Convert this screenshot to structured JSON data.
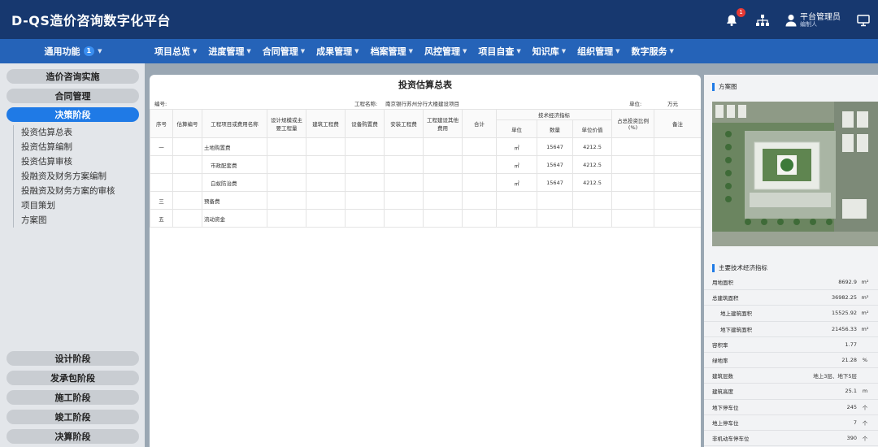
{
  "header": {
    "title": "D-QS造价咨询数字化平台",
    "notification_count": "1",
    "user_name": "平台管理员",
    "user_role": "编制人"
  },
  "nav": {
    "general_label": "通用功能",
    "general_count": "1",
    "items": [
      "项目总览",
      "进度管理",
      "合同管理",
      "成果管理",
      "档案管理",
      "风控管理",
      "项目自查",
      "知识库",
      "组织管理",
      "数字服务"
    ]
  },
  "sidebar": {
    "stages_top": [
      "造价咨询实施",
      "合同管理",
      "决策阶段"
    ],
    "active_stage": "决策阶段",
    "sub_items": [
      "投资估算总表",
      "投资估算编制",
      "投资估算审核",
      "投融资及财务方案编制",
      "投融资及财务方案的审核",
      "项目策划",
      "方案图"
    ],
    "stages_bottom": [
      "设计阶段",
      "发承包阶段",
      "施工阶段",
      "竣工阶段",
      "决算阶段"
    ]
  },
  "table": {
    "title": "投资估算总表",
    "code_label": "编号:",
    "project_label": "工程名称:",
    "project_name": "南京银行苏州分行大楼建设项目",
    "unit_label": "单位:",
    "unit_value": "万元",
    "headers": {
      "seq": "序号",
      "code": "估算编号",
      "name": "工程项目或费用名称",
      "design": "设计规模或主要工程量",
      "build": "建筑工程费",
      "equip": "设备购置费",
      "install": "安装工程费",
      "other": "工程建设其他费用",
      "total": "合计",
      "tech_group": "技术经济指标",
      "t_unit": "单位",
      "t_qty": "数量",
      "t_price": "单位价值",
      "ratio": "占总投资比例(%)",
      "note": "备注"
    },
    "rows": [
      {
        "seq": "一",
        "name": "土地购置费",
        "unit": "㎡",
        "qty": "15647",
        "price": "4212.5"
      },
      {
        "seq": "",
        "name": "市政配套费",
        "unit": "㎡",
        "qty": "15647",
        "price": "4212.5"
      },
      {
        "seq": "",
        "name": "白蚁防治费",
        "unit": "㎡",
        "qty": "15647",
        "price": "4212.5"
      },
      {
        "seq": "三",
        "name": "预备费",
        "unit": "",
        "qty": "",
        "price": ""
      },
      {
        "seq": "五",
        "name": "流动资金",
        "unit": "",
        "qty": "",
        "price": ""
      }
    ]
  },
  "right": {
    "plan_title": "方案图",
    "metrics_title": "主要技术经济指标",
    "metrics": [
      {
        "label": "用地面积",
        "value": "8692.9",
        "unit": "m²"
      },
      {
        "label": "总建筑面积",
        "value": "36982.25",
        "unit": "m²"
      },
      {
        "label": "地上建筑面积",
        "value": "15525.92",
        "unit": "m²"
      },
      {
        "label": "地下建筑面积",
        "value": "21456.33",
        "unit": "m²"
      },
      {
        "label": "容积率",
        "value": "1.77",
        "unit": ""
      },
      {
        "label": "绿地率",
        "value": "21.28",
        "unit": "%"
      },
      {
        "label": "建筑层数",
        "value": "地上3层、地下5层",
        "unit": ""
      },
      {
        "label": "建筑高度",
        "value": "25.1",
        "unit": "m"
      },
      {
        "label": "地下停车位",
        "value": "245",
        "unit": "个"
      },
      {
        "label": "地上停车位",
        "value": "7",
        "unit": "个"
      },
      {
        "label": "非机动车停车位",
        "value": "390",
        "unit": "个"
      }
    ]
  },
  "colors": {
    "header_bg": "#17386f",
    "nav_bg": "#2563b8",
    "accent": "#1f7ae6",
    "badge": "#e53935"
  }
}
